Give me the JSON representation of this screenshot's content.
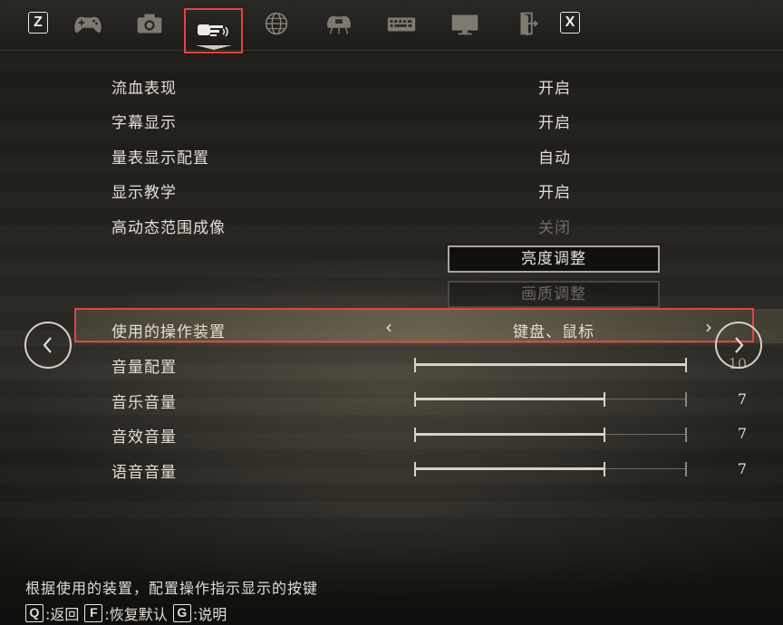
{
  "topbar": {
    "left_key": "Z",
    "right_key": "X",
    "tabs": [
      {
        "icon": "gamepad-icon",
        "active": false
      },
      {
        "icon": "camera-icon",
        "active": false
      },
      {
        "icon": "display-sound-icon",
        "active": true
      },
      {
        "icon": "globe-icon",
        "active": false
      },
      {
        "icon": "controller-settings-icon",
        "active": false
      },
      {
        "icon": "keyboard-icon",
        "active": false
      },
      {
        "icon": "monitor-icon",
        "active": false
      },
      {
        "icon": "exit-door-icon",
        "active": false
      }
    ]
  },
  "settings": {
    "blood": {
      "label": "流血表现",
      "value": "开启"
    },
    "subtitles": {
      "label": "字幕显示",
      "value": "开启"
    },
    "hud": {
      "label": "量表显示配置",
      "value": "自动"
    },
    "tutorials": {
      "label": "显示教学",
      "value": "开启"
    },
    "hdr": {
      "label": "高动态范围成像",
      "value": "关闭"
    },
    "brightness_button": "亮度调整",
    "quality_button": "画质调整",
    "device": {
      "label": "使用的操作装置",
      "value": "键盘、鼠标"
    },
    "master_volume": {
      "label": "音量配置",
      "value": "10",
      "level": 1.0
    },
    "music_volume": {
      "label": "音乐音量",
      "value": "7",
      "level": 0.7
    },
    "sfx_volume": {
      "label": "音效音量",
      "value": "7",
      "level": 0.7
    },
    "voice_volume": {
      "label": "语音音量",
      "value": "7",
      "level": 0.7
    }
  },
  "hint_text": "根据使用的装置，配置操作指示显示的按键",
  "footer": {
    "back_key": "Q",
    "back_label": ":返回",
    "reset_key": "F",
    "reset_label": ":恢复默认",
    "help_key": "G",
    "help_label": ":说明"
  },
  "colors": {
    "highlight_frame": "#e0453e",
    "text": "#e2ded2",
    "disabled_text": "#6e6b61"
  }
}
